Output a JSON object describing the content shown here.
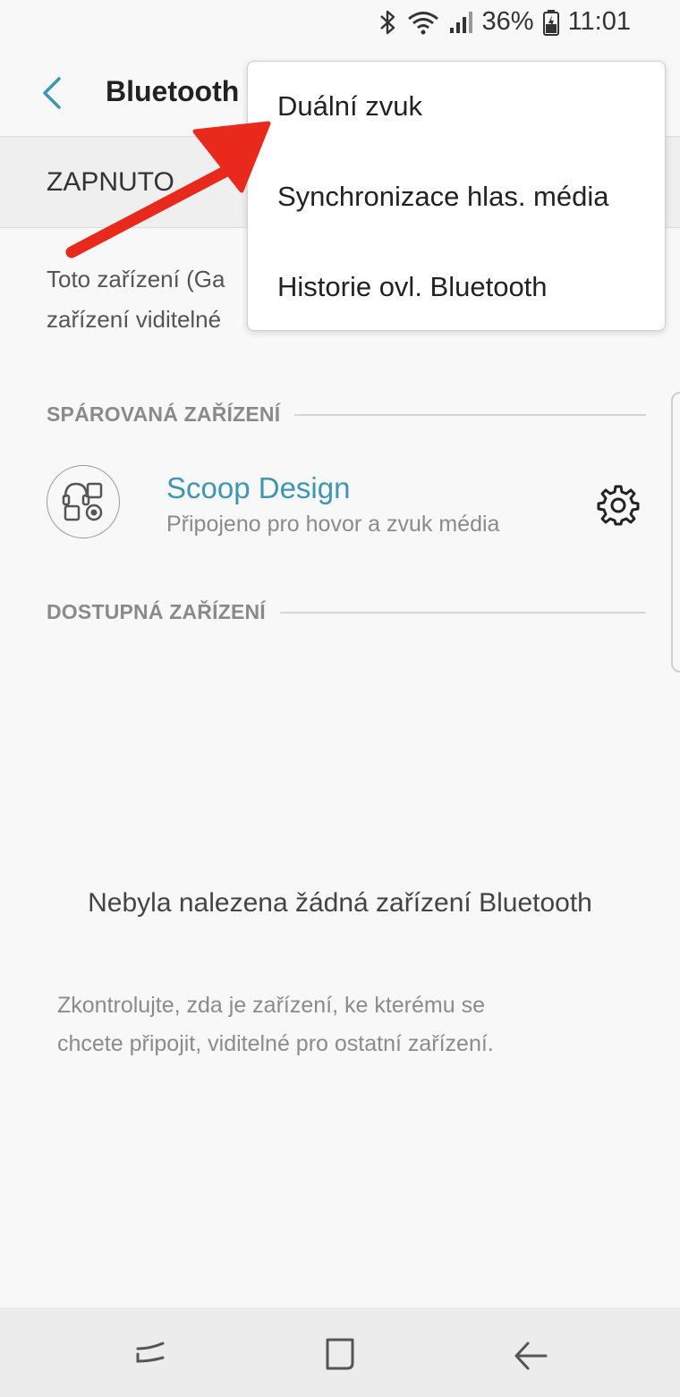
{
  "status_bar": {
    "battery": "36%",
    "time": "11:01"
  },
  "header": {
    "title": "Bluetooth"
  },
  "switch": {
    "label": "ZAPNUTO"
  },
  "description": {
    "line1": "Toto zařízení (Ga",
    "line2": "zařízení viditelné"
  },
  "paired": {
    "section_label": "SPÁROVANÁ ZAŘÍZENÍ",
    "devices": [
      {
        "name": "Scoop Design",
        "status": "Připojeno pro hovor a zvuk média"
      }
    ]
  },
  "available": {
    "section_label": "DOSTUPNÁ ZAŘÍZENÍ"
  },
  "empty_state": {
    "title": "Nebyla nalezena žádná zařízení Bluetooth",
    "line1": "Zkontrolujte, zda je zařízení, ke kterému se",
    "line2": "chcete připojit, viditelné pro ostatní zařízení."
  },
  "menu": {
    "items": [
      {
        "label": "Duální zvuk"
      },
      {
        "label": "Synchronizace hlas. média"
      },
      {
        "label": "Historie ovl. Bluetooth"
      }
    ]
  },
  "colors": {
    "accent": "#3e96b3",
    "annotation": "#e8291c"
  },
  "icons": {
    "back": "chevron-left-icon",
    "device": "peripheral-device-icon",
    "settings": "gear-icon",
    "nav_recents": "recents-icon",
    "nav_home": "home-icon",
    "nav_back": "back-arrow-icon"
  }
}
